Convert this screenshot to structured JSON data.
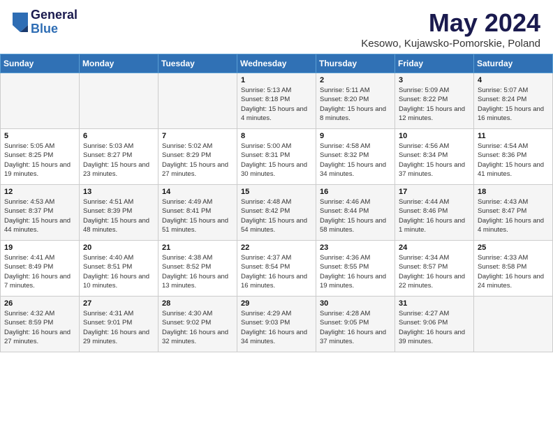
{
  "header": {
    "logo_general": "General",
    "logo_blue": "Blue",
    "month_title": "May 2024",
    "location": "Kesowo, Kujawsko-Pomorskie, Poland"
  },
  "days_of_week": [
    "Sunday",
    "Monday",
    "Tuesday",
    "Wednesday",
    "Thursday",
    "Friday",
    "Saturday"
  ],
  "weeks": [
    [
      {
        "day": "",
        "info": ""
      },
      {
        "day": "",
        "info": ""
      },
      {
        "day": "",
        "info": ""
      },
      {
        "day": "1",
        "info": "Sunrise: 5:13 AM\nSunset: 8:18 PM\nDaylight: 15 hours and 4 minutes."
      },
      {
        "day": "2",
        "info": "Sunrise: 5:11 AM\nSunset: 8:20 PM\nDaylight: 15 hours and 8 minutes."
      },
      {
        "day": "3",
        "info": "Sunrise: 5:09 AM\nSunset: 8:22 PM\nDaylight: 15 hours and 12 minutes."
      },
      {
        "day": "4",
        "info": "Sunrise: 5:07 AM\nSunset: 8:24 PM\nDaylight: 15 hours and 16 minutes."
      }
    ],
    [
      {
        "day": "5",
        "info": "Sunrise: 5:05 AM\nSunset: 8:25 PM\nDaylight: 15 hours and 19 minutes."
      },
      {
        "day": "6",
        "info": "Sunrise: 5:03 AM\nSunset: 8:27 PM\nDaylight: 15 hours and 23 minutes."
      },
      {
        "day": "7",
        "info": "Sunrise: 5:02 AM\nSunset: 8:29 PM\nDaylight: 15 hours and 27 minutes."
      },
      {
        "day": "8",
        "info": "Sunrise: 5:00 AM\nSunset: 8:31 PM\nDaylight: 15 hours and 30 minutes."
      },
      {
        "day": "9",
        "info": "Sunrise: 4:58 AM\nSunset: 8:32 PM\nDaylight: 15 hours and 34 minutes."
      },
      {
        "day": "10",
        "info": "Sunrise: 4:56 AM\nSunset: 8:34 PM\nDaylight: 15 hours and 37 minutes."
      },
      {
        "day": "11",
        "info": "Sunrise: 4:54 AM\nSunset: 8:36 PM\nDaylight: 15 hours and 41 minutes."
      }
    ],
    [
      {
        "day": "12",
        "info": "Sunrise: 4:53 AM\nSunset: 8:37 PM\nDaylight: 15 hours and 44 minutes."
      },
      {
        "day": "13",
        "info": "Sunrise: 4:51 AM\nSunset: 8:39 PM\nDaylight: 15 hours and 48 minutes."
      },
      {
        "day": "14",
        "info": "Sunrise: 4:49 AM\nSunset: 8:41 PM\nDaylight: 15 hours and 51 minutes."
      },
      {
        "day": "15",
        "info": "Sunrise: 4:48 AM\nSunset: 8:42 PM\nDaylight: 15 hours and 54 minutes."
      },
      {
        "day": "16",
        "info": "Sunrise: 4:46 AM\nSunset: 8:44 PM\nDaylight: 15 hours and 58 minutes."
      },
      {
        "day": "17",
        "info": "Sunrise: 4:44 AM\nSunset: 8:46 PM\nDaylight: 16 hours and 1 minute."
      },
      {
        "day": "18",
        "info": "Sunrise: 4:43 AM\nSunset: 8:47 PM\nDaylight: 16 hours and 4 minutes."
      }
    ],
    [
      {
        "day": "19",
        "info": "Sunrise: 4:41 AM\nSunset: 8:49 PM\nDaylight: 16 hours and 7 minutes."
      },
      {
        "day": "20",
        "info": "Sunrise: 4:40 AM\nSunset: 8:51 PM\nDaylight: 16 hours and 10 minutes."
      },
      {
        "day": "21",
        "info": "Sunrise: 4:38 AM\nSunset: 8:52 PM\nDaylight: 16 hours and 13 minutes."
      },
      {
        "day": "22",
        "info": "Sunrise: 4:37 AM\nSunset: 8:54 PM\nDaylight: 16 hours and 16 minutes."
      },
      {
        "day": "23",
        "info": "Sunrise: 4:36 AM\nSunset: 8:55 PM\nDaylight: 16 hours and 19 minutes."
      },
      {
        "day": "24",
        "info": "Sunrise: 4:34 AM\nSunset: 8:57 PM\nDaylight: 16 hours and 22 minutes."
      },
      {
        "day": "25",
        "info": "Sunrise: 4:33 AM\nSunset: 8:58 PM\nDaylight: 16 hours and 24 minutes."
      }
    ],
    [
      {
        "day": "26",
        "info": "Sunrise: 4:32 AM\nSunset: 8:59 PM\nDaylight: 16 hours and 27 minutes."
      },
      {
        "day": "27",
        "info": "Sunrise: 4:31 AM\nSunset: 9:01 PM\nDaylight: 16 hours and 29 minutes."
      },
      {
        "day": "28",
        "info": "Sunrise: 4:30 AM\nSunset: 9:02 PM\nDaylight: 16 hours and 32 minutes."
      },
      {
        "day": "29",
        "info": "Sunrise: 4:29 AM\nSunset: 9:03 PM\nDaylight: 16 hours and 34 minutes."
      },
      {
        "day": "30",
        "info": "Sunrise: 4:28 AM\nSunset: 9:05 PM\nDaylight: 16 hours and 37 minutes."
      },
      {
        "day": "31",
        "info": "Sunrise: 4:27 AM\nSunset: 9:06 PM\nDaylight: 16 hours and 39 minutes."
      },
      {
        "day": "",
        "info": ""
      }
    ]
  ]
}
